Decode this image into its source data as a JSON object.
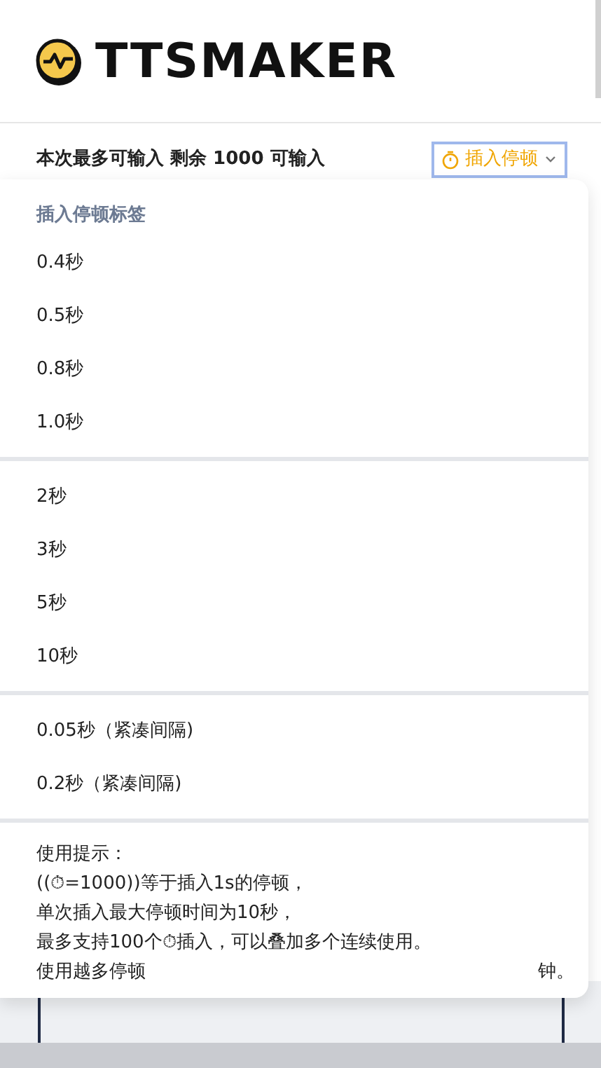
{
  "logo": {
    "text": "TTSMAKER"
  },
  "input_info": {
    "label": "本次最多可输入 剩余 1000 可输入"
  },
  "pause_button": {
    "label": "插入停顿",
    "expanded": true
  },
  "pause_menu": {
    "header": "插入停顿标签",
    "groups": [
      [
        "0.4秒",
        "0.5秒",
        "0.8秒",
        "1.0秒"
      ],
      [
        "2秒",
        "3秒",
        "5秒",
        "10秒"
      ],
      [
        "0.05秒（紧凑间隔)",
        "0.2秒（紧凑间隔)"
      ]
    ],
    "tips": [
      "使用提示：",
      "((⏱=1000))等于插入1s的停顿，",
      "单次插入最大停顿时间为10秒，",
      "最多支持100个⏱插入，可以叠加多个连续使用。"
    ],
    "last_tip_parts": [
      "使用越多停顿",
      "钟。"
    ]
  }
}
